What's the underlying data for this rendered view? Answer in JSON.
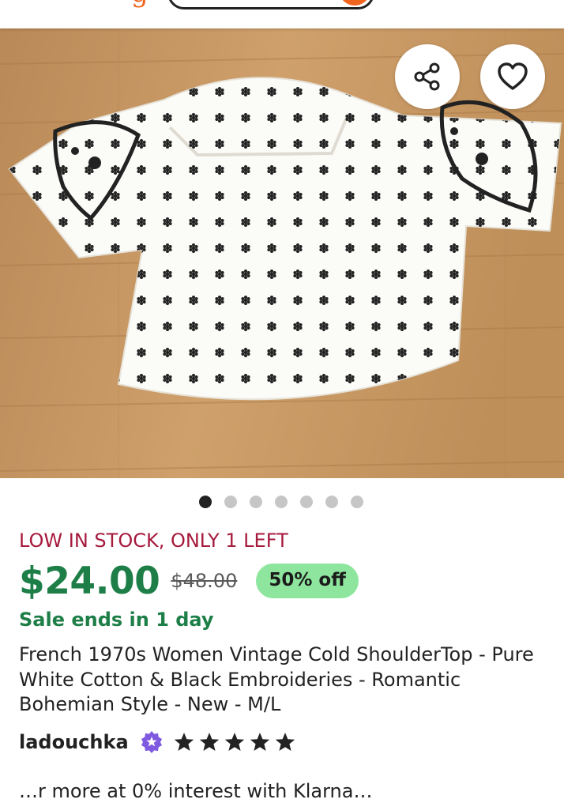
{
  "header": {
    "logo_fragment": "g"
  },
  "gallery": {
    "total_images": 7,
    "active_index": 0,
    "share_icon": "share-icon",
    "favorite_icon": "heart-outline-icon"
  },
  "listing": {
    "stock_text": "LOW IN STOCK, ONLY 1 LEFT",
    "price": "$24.00",
    "original_price": "$48.00",
    "discount": "50% off",
    "sale_ends": "Sale ends in 1 day",
    "title": "French 1970s Women Vintage Cold ShoulderTop - Pure White Cotton & Black Embroideries - Romantic Bohemian Style - New - M/L",
    "shop_name": "ladouchka",
    "rating": 5,
    "star_icon": "star-icon",
    "badge_icon": "star-seller-badge-icon",
    "truncated_line": "…r more at 0% interest with Klarna…"
  },
  "colors": {
    "brand_orange": "#f1641e",
    "price_green": "#1d7f47",
    "stock_red": "#a61a3c",
    "discount_bg": "#8ee69e",
    "badge_purple": "#7f5ae0"
  }
}
